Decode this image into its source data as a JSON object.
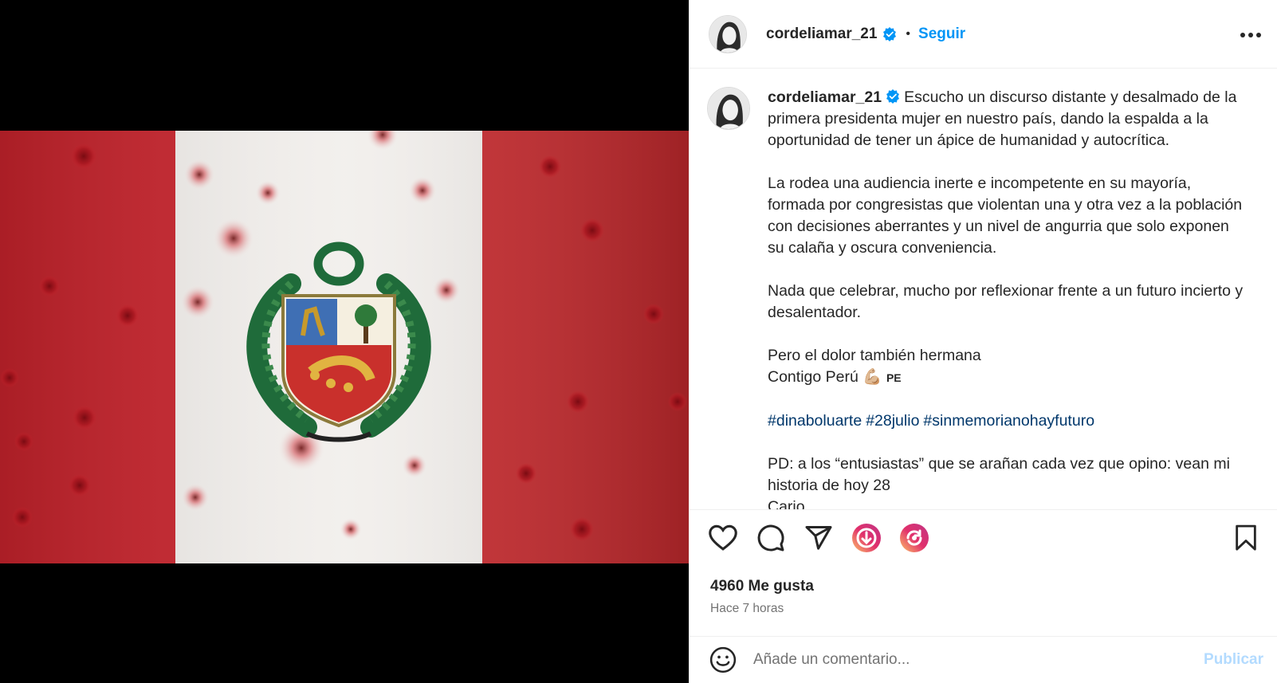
{
  "post": {
    "username": "cordeliamar_21",
    "follow_label": "Seguir",
    "separator": "•",
    "more_icon": "more-horizontal-icon",
    "verified_icon": "verified-badge-icon",
    "accent_color": "#0095f6"
  },
  "media": {
    "image_kind": "peru-flag-photo",
    "colors": {
      "red": "#c8232c",
      "white": "#f2efec"
    }
  },
  "caption": {
    "username": "cordeliamar_21",
    "p1": "Escucho un discurso distante y desalmado de la primera presidenta mujer en nuestro país, dando la espalda a la oportunidad de tener un ápice de humanidad y autocrítica.",
    "p2": "La rodea una audiencia inerte e incompetente en su mayoría, formada por congresistas que violentan una y otra vez a la población con decisiones aberrantes y un nivel de angurria que solo exponen su calaña y oscura conveniencia.",
    "p3": "Nada que celebrar, mucho por reflexionar frente a un futuro incierto y desalentador.",
    "p4_line1": "Pero el dolor también hermana",
    "p4_line2": "Contigo Perú",
    "p4_emoji": "💪🏼",
    "p4_flag": "PE",
    "hashtags": [
      "#dinaboluarte",
      "#28julio",
      "#sinmemorianohayfuturo"
    ],
    "p5": "PD: a los “entusiastas” que se arañan cada vez que opino: vean mi historia de hoy 28",
    "p6_cut": "Cario..."
  },
  "actions": {
    "like_icon": "heart-icon",
    "comment_icon": "comment-icon",
    "share_icon": "share-icon",
    "remix_icon": "remix-icon",
    "repost_icon": "repost-icon",
    "save_icon": "bookmark-icon"
  },
  "stats": {
    "likes": "4960 Me gusta",
    "time_ago": "Hace 7 horas"
  },
  "comment": {
    "placeholder": "Añade un comentario...",
    "publish_label": "Publicar",
    "emoji_icon": "emoji-icon"
  }
}
